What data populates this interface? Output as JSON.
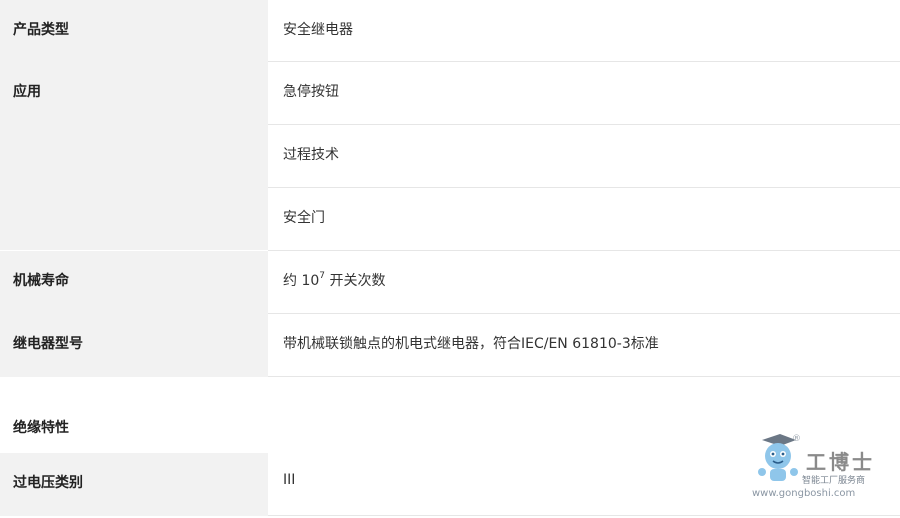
{
  "rows": [
    {
      "label": "产品类型",
      "values": [
        "安全继电器"
      ]
    },
    {
      "label": "应用",
      "values": [
        "急停按钮",
        "过程技术",
        "安全门"
      ]
    },
    {
      "label": "机械寿命",
      "value_prefix": "约 10",
      "value_sup": "7",
      "value_suffix": " 开关次数"
    },
    {
      "label": "继电器型号",
      "values": [
        "带机械联锁触点的机电式继电器，符合IEC/EN 61810-3标准"
      ]
    }
  ],
  "section": {
    "title": "绝缘特性"
  },
  "rows2": [
    {
      "label": "过电压类别",
      "values": [
        "III"
      ]
    }
  ],
  "watermark": {
    "brand": "工博士",
    "tagline": "智能工厂服务商",
    "url": "www.gongboshi.com",
    "reg": "®"
  }
}
